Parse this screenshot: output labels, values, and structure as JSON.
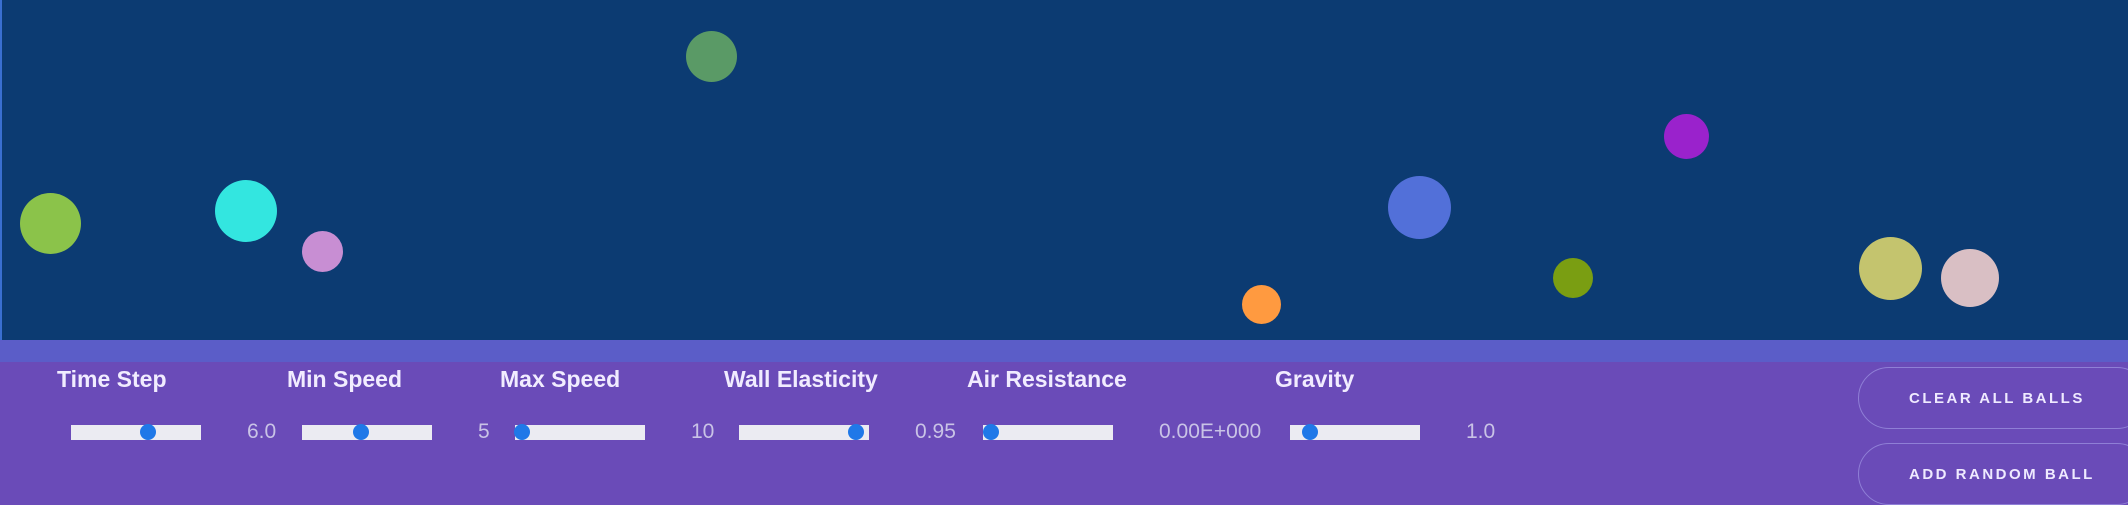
{
  "balls": [
    {
      "color": "#8bc34a"
    },
    {
      "color": "#33e6e0"
    },
    {
      "color": "#c88ed3"
    },
    {
      "color": "#5a9a66"
    },
    {
      "color": "#ff9a40"
    },
    {
      "color": "#5270d9"
    },
    {
      "color": "#7a9e12"
    },
    {
      "color": "#9a22cc"
    },
    {
      "color": "#c4c46e"
    },
    {
      "color": "#d9bfc4"
    }
  ],
  "controls": [
    {
      "label": "Time Step",
      "value_text": "6.0",
      "slider_fraction": 0.59
    },
    {
      "label": "Min Speed",
      "value_text": "5",
      "slider_fraction": 0.45
    },
    {
      "label": "Max Speed",
      "value_text": "10",
      "slider_fraction": 0.05
    },
    {
      "label": "Wall Elasticity",
      "value_text": "0.95",
      "slider_fraction": 0.9
    },
    {
      "label": "Air Resistance",
      "value_text": "0.00E+000",
      "slider_fraction": 0.06
    },
    {
      "label": "Gravity",
      "value_text": "1.0",
      "slider_fraction": 0.15
    }
  ],
  "buttons": {
    "clear_label": "CLEAR ALL BALLS",
    "add_label": "ADD RANDOM BALL"
  },
  "colors": {
    "canvas_bg": "#0c3b72",
    "panel_bg": "#6a4bb8",
    "slider_thumb": "#1f78e8"
  }
}
